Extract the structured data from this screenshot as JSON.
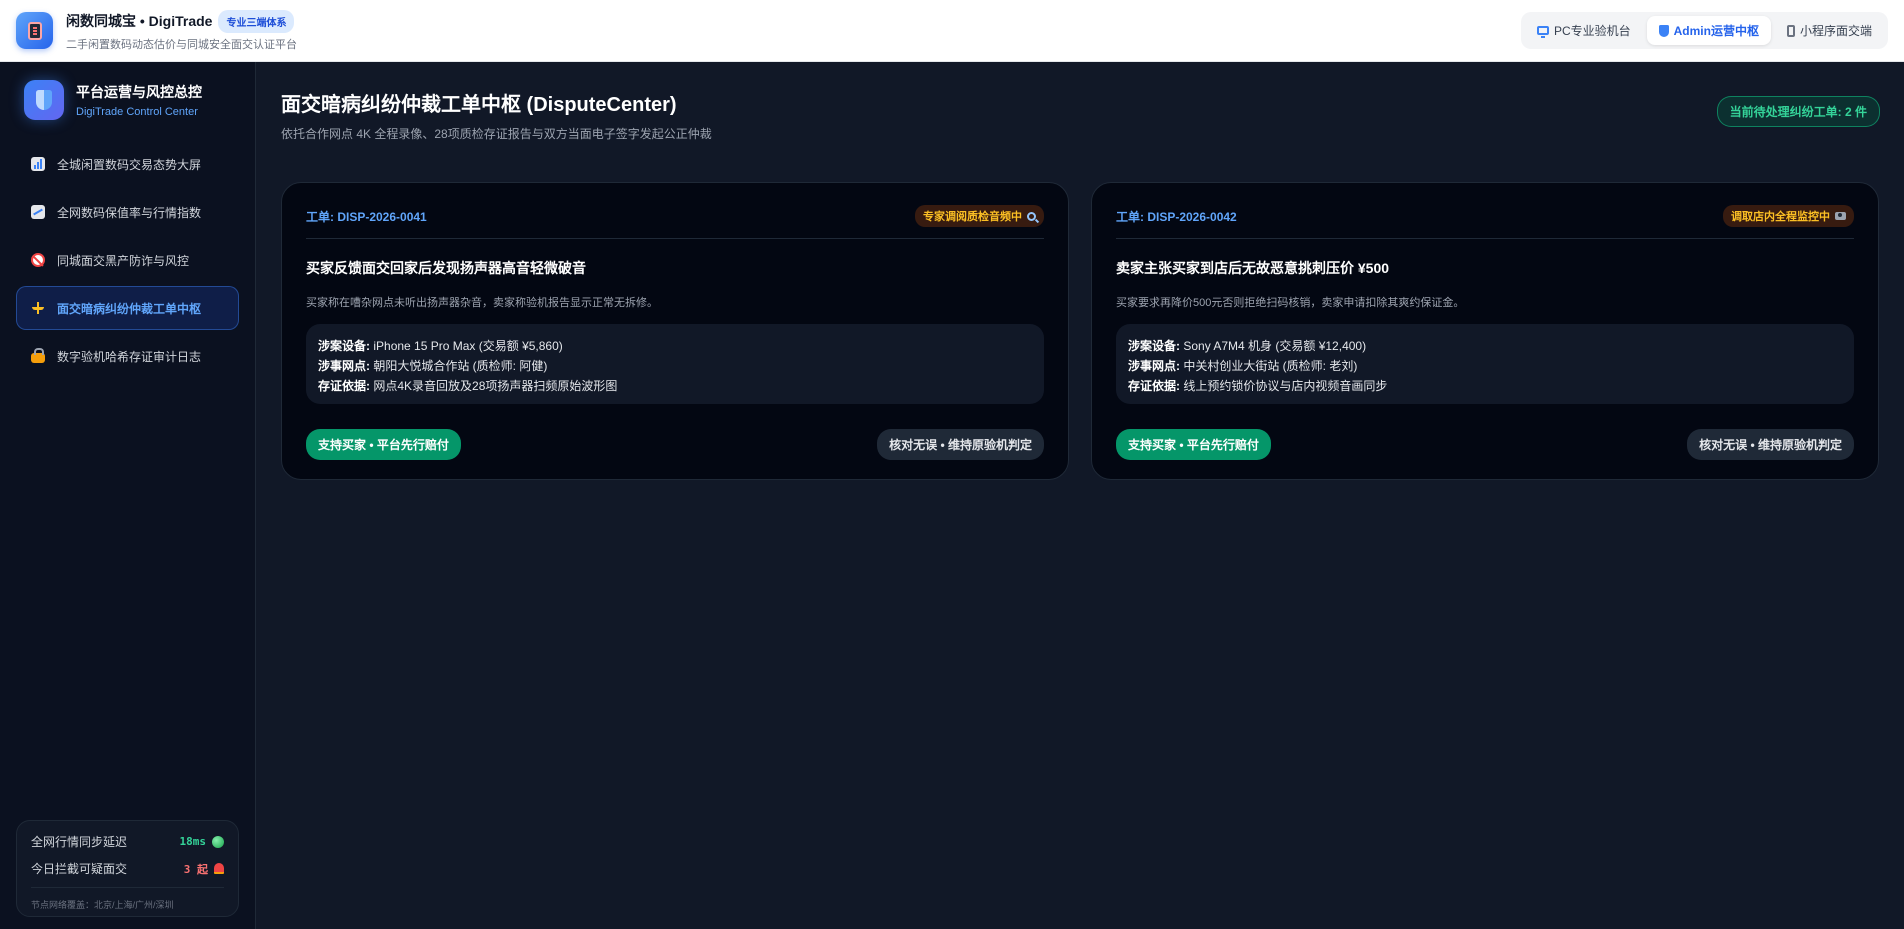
{
  "app": {
    "title": "闲数同城宝 • DigiTrade",
    "badge": "专业三端体系",
    "subtitle": "二手闲置数码动态估价与同城安全面交认证平台"
  },
  "mode_switch": [
    {
      "label": "PC专业验机台",
      "icon": "monitor-icon",
      "active": false
    },
    {
      "label": "Admin运营中枢",
      "icon": "shield-icon",
      "active": true
    },
    {
      "label": "小程序面交端",
      "icon": "phone-icon",
      "active": false
    }
  ],
  "sidebar": {
    "title": "平台运营与风控总控",
    "subtitle": "DigiTrade Control Center",
    "items": [
      {
        "label": "全城闲置数码交易态势大屏",
        "icon": "bar-chart-icon",
        "active": false
      },
      {
        "label": "全网数码保值率与行情指数",
        "icon": "trend-chart-icon",
        "active": false
      },
      {
        "label": "同城面交黑产防诈与风控",
        "icon": "prohibited-icon",
        "active": false
      },
      {
        "label": "面交暗病纠纷仲裁工单中枢",
        "icon": "scale-icon",
        "active": true
      },
      {
        "label": "数字验机哈希存证审计日志",
        "icon": "lock-icon",
        "active": false
      }
    ],
    "status": {
      "sync_label": "全网行情同步延迟",
      "sync_value": "18ms",
      "intercept_label": "今日拦截可疑面交",
      "intercept_value": "3 起",
      "nodes": "节点网络覆盖：北京/上海/广州/深圳"
    }
  },
  "main": {
    "title": "面交暗病纠纷仲裁工单中枢 (DisputeCenter)",
    "subtitle": "依托合作网点 4K 全程录像、28项质检存证报告与双方当面电子签字发起公正仲裁",
    "pending": "当前待处理纠纷工单: 2 件",
    "tickets": [
      {
        "id": "工单: DISP-2026-0041",
        "status": "专家调阅质检音频中",
        "status_icon": "magnifier-icon",
        "title": "买家反馈面交回家后发现扬声器高音轻微破音",
        "desc": "买家称在嘈杂网点未听出扬声器杂音，卖家称验机报告显示正常无拆修。",
        "device_key": "涉案设备:",
        "device_val": "iPhone 15 Pro Max (交易额 ¥5,860)",
        "site_key": "涉事网点:",
        "site_val": "朝阳大悦城合作站 (质检师: 阿健)",
        "evidence_key": "存证依据:",
        "evidence_val": "网点4K录音回放及28项扬声器扫频原始波形图",
        "btn_support": "支持买家 • 平台先行赔付",
        "btn_keep": "核对无误 • 维持原验机判定"
      },
      {
        "id": "工单: DISP-2026-0042",
        "status": "调取店内全程监控中",
        "status_icon": "camera-icon",
        "title": "卖家主张买家到店后无故恶意挑刺压价 ¥500",
        "desc": "买家要求再降价500元否则拒绝扫码核销，卖家申请扣除其爽约保证金。",
        "device_key": "涉案设备:",
        "device_val": "Sony A7M4 机身 (交易额 ¥12,400)",
        "site_key": "涉事网点:",
        "site_val": "中关村创业大街站 (质检师: 老刘)",
        "evidence_key": "存证依据:",
        "evidence_val": "线上预约锁价协议与店内视频音画同步",
        "btn_support": "支持买家 • 平台先行赔付",
        "btn_keep": "核对无误 • 维持原验机判定"
      }
    ]
  }
}
